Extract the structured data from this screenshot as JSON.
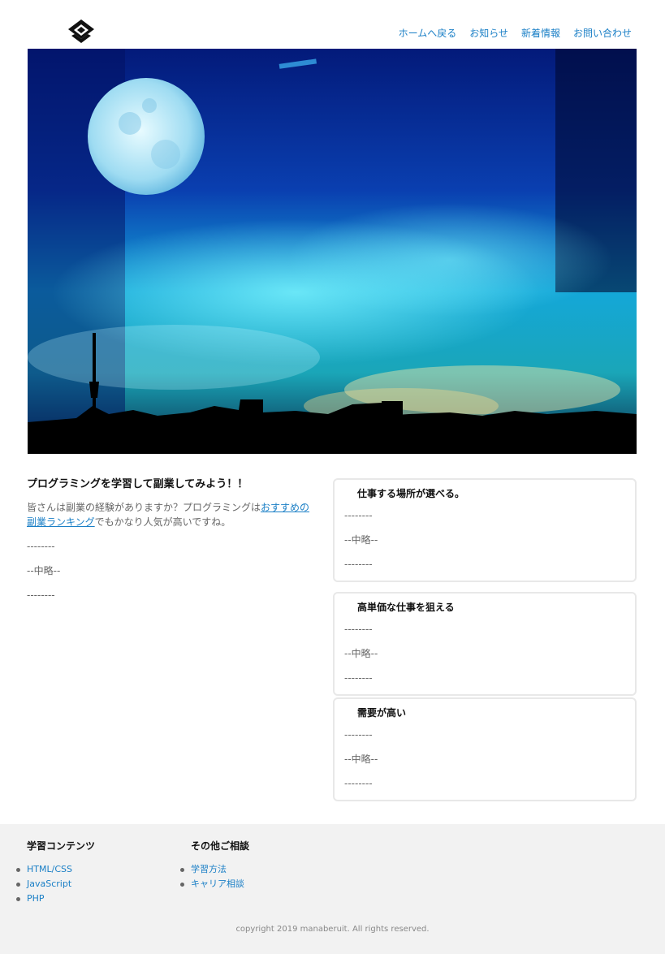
{
  "header": {
    "logo_icon": "family-crest-icon",
    "nav": [
      "ホームへ戻る",
      "お知らせ",
      "新着情報",
      "お問い合わせ"
    ]
  },
  "hero": {
    "image": "night-sky-moon-city-skyline"
  },
  "main": {
    "title": "プログラミングを学習して副業してみよう！！",
    "intro_before": "皆さんは副業の経験がありますか？プログラミングは",
    "intro_link": "おすすめの副業ランキング",
    "intro_after": "でもかなり人気が高いですね。",
    "lines": [
      "--------",
      "--中略--",
      "--------"
    ]
  },
  "cards": [
    {
      "title": "仕事する場所が選べる。",
      "lines": [
        "--------",
        "--中略--",
        "--------"
      ]
    },
    {
      "title": "高単価な仕事を狙える",
      "lines": [
        "--------",
        "--中略--",
        "--------"
      ]
    },
    {
      "title": "需要が高い",
      "lines": [
        "--------",
        "--中略--",
        "--------"
      ]
    }
  ],
  "footer": {
    "col1": {
      "title": "学習コンテンツ",
      "items": [
        "HTML/CSS",
        "JavaScript",
        "PHP"
      ]
    },
    "col2": {
      "title": "その他ご相談",
      "items": [
        "学習方法",
        "キャリア相談"
      ]
    },
    "copyright": "copyright 2019 manaberuit. All rights reserved."
  },
  "colors": {
    "link": "#1a7fc6",
    "footer_bg": "#f2f2f2",
    "card_border": "#e8e8e8"
  }
}
